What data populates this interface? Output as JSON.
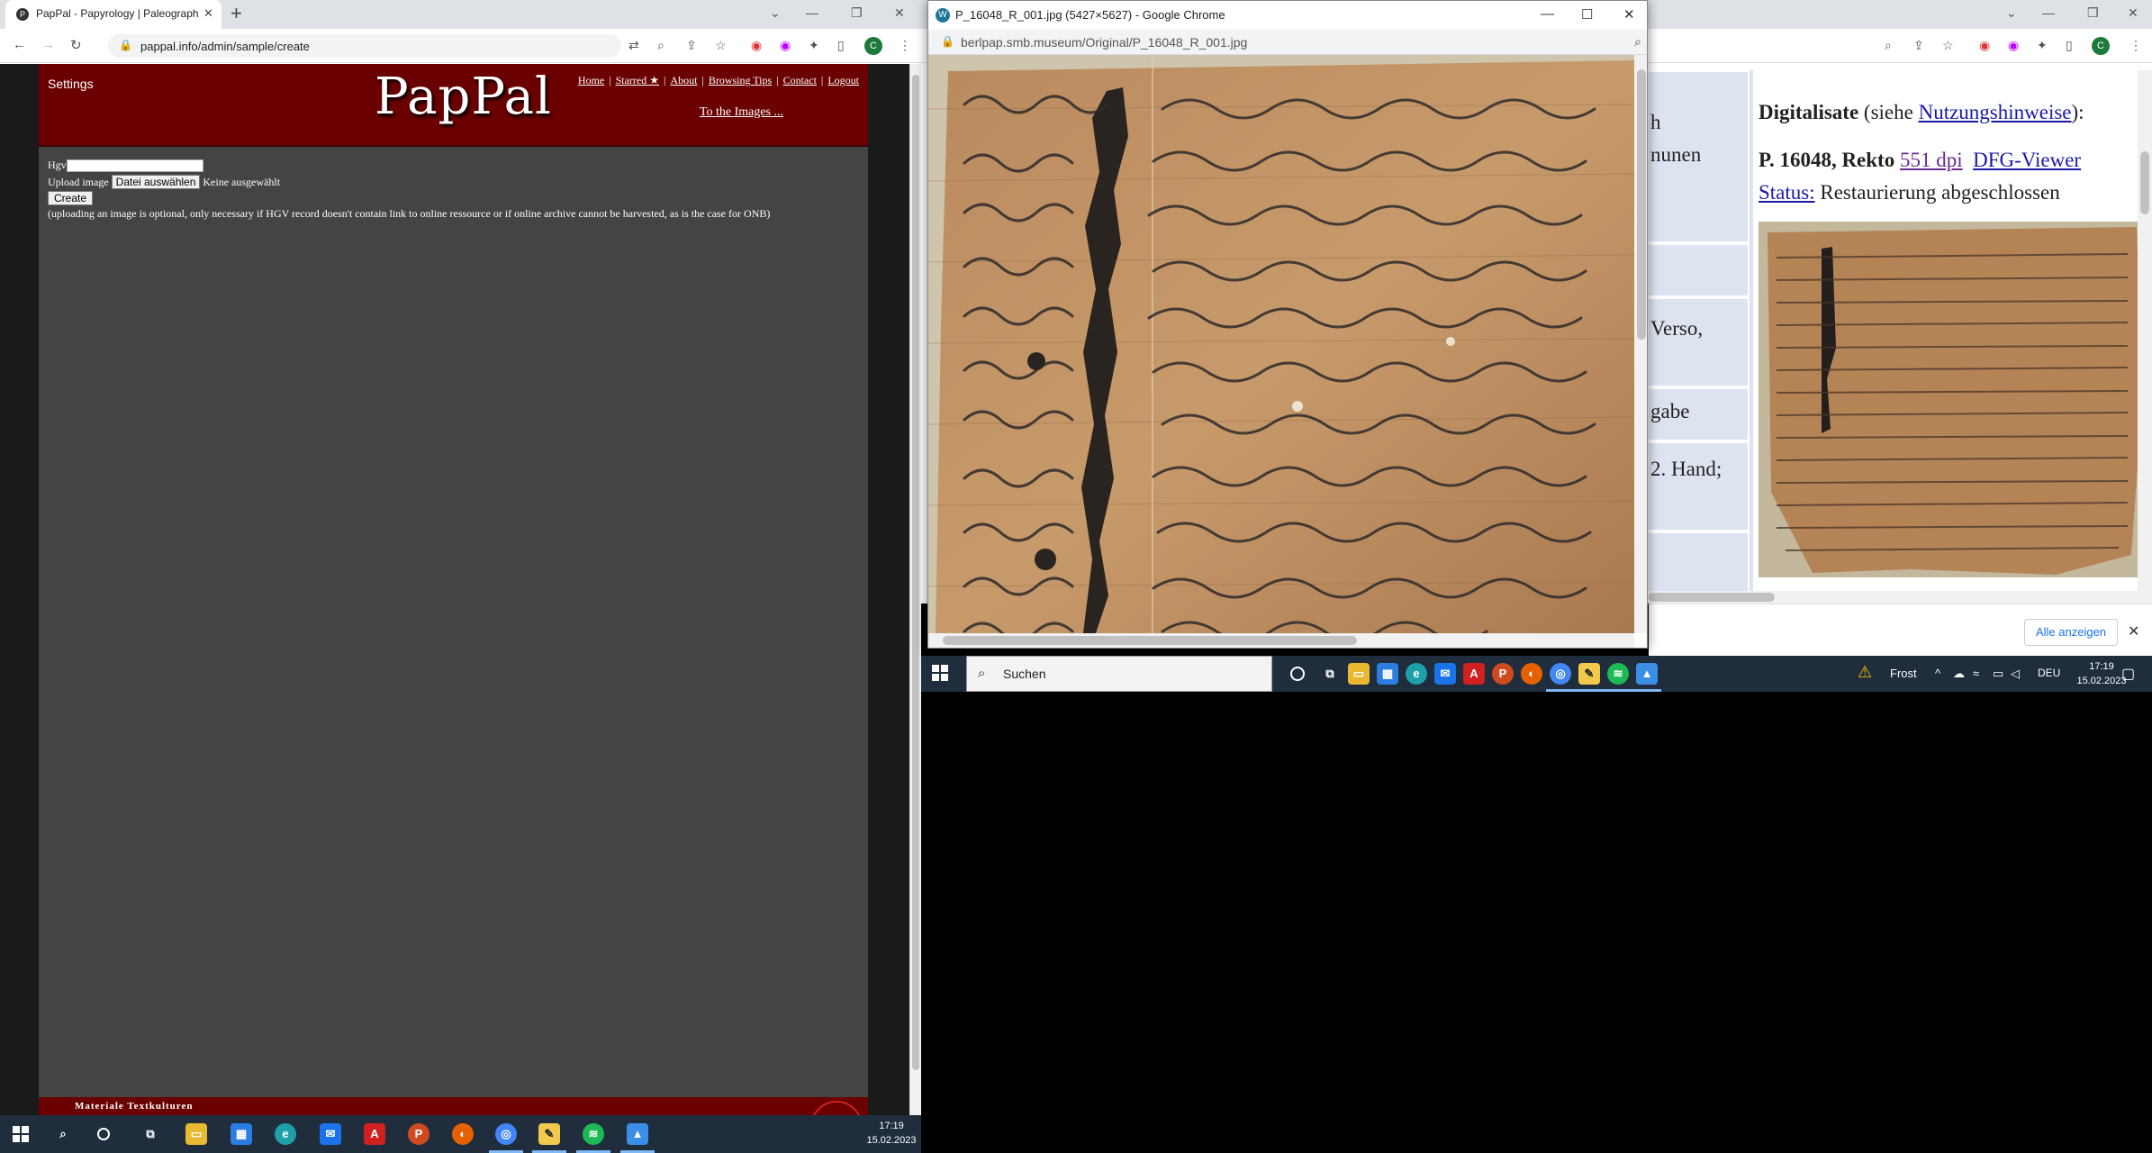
{
  "left_browser": {
    "tab_title": "PapPal - Papyrology | Paleograph",
    "url": "pappal.info/admin/sample/create",
    "profile_initial": "C"
  },
  "pappal": {
    "settings": "Settings",
    "logo": "PapPal",
    "nav": [
      "Home",
      "Starred ★",
      "About",
      "Browsing Tips",
      "Contact",
      "Logout"
    ],
    "to_images": "To the Images ...",
    "form": {
      "hgv_label": "Hgv",
      "hgv_value": "",
      "upload_label": "Upload image",
      "file_button": "Datei auswählen",
      "file_status": "Keine ausgewählt",
      "create_button": "Create",
      "note": "(uploading an image is optional, only necessary if HGV record doesn't contain link to online ressource or if online archive cannot be harvested, as is the case for ONB)"
    },
    "footer_text": "Materiale Textkulturen"
  },
  "popup": {
    "title": "P_16048_R_001.jpg (5427×5627) - Google Chrome",
    "url": "berlpap.smb.museum/Original/P_16048_R_001.jpg"
  },
  "right_browser": {
    "partial_cells": [
      "h",
      "nunen",
      "Verso,",
      "gabe",
      "2. Hand;"
    ],
    "digit_heading_bold": "Digitalisate",
    "digit_heading_rest": " (siehe ",
    "digit_heading_link": "Nutzungshinweise",
    "digit_heading_end": "):",
    "record_bold": "P. 16048, Rekto",
    "link_dpi": "551 dpi",
    "link_dfg": "DFG-Viewer",
    "status_label": "Status:",
    "status_value": " Restaurierung abgeschlossen",
    "download_button": "Alle anzeigen",
    "profile_initial": "C"
  },
  "taskbar_right": {
    "search_placeholder": "Suchen",
    "weather": "Frost",
    "language": "DEU",
    "time": "17:19",
    "date": "15.02.2023"
  },
  "taskbar_left": {
    "time": "17:19",
    "date": "15.02.2023"
  },
  "colors": {
    "pappal_header": "#6a0000",
    "pappal_page": "#444444",
    "taskbar": "#1f2d3d",
    "link": "#1a1aa6"
  }
}
